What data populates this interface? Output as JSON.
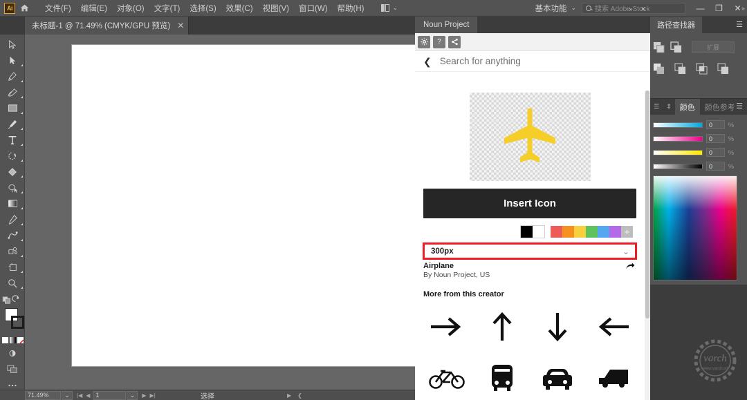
{
  "app": {
    "logo": "Ai",
    "home_icon": "home-icon",
    "workspace": "基本功能",
    "stock_placeholder": "搜索 Adobe Stock",
    "window_buttons": [
      "—",
      "❐",
      "✕"
    ]
  },
  "menu": {
    "items": [
      {
        "label": "文件(F)"
      },
      {
        "label": "编辑(E)"
      },
      {
        "label": "对象(O)"
      },
      {
        "label": "文字(T)"
      },
      {
        "label": "选择(S)"
      },
      {
        "label": "效果(C)"
      },
      {
        "label": "视图(V)"
      },
      {
        "label": "窗口(W)"
      },
      {
        "label": "帮助(H)"
      }
    ]
  },
  "document_tab": {
    "title": "未标题-1 @ 71.49% (CMYK/GPU 预览)",
    "close": "✕"
  },
  "toolbar": {
    "tools": [
      {
        "name": "selection-tool"
      },
      {
        "name": "direct-selection-tool"
      },
      {
        "name": "pen-tool"
      },
      {
        "name": "curvature-tool"
      },
      {
        "name": "rectangle-tool"
      },
      {
        "name": "paintbrush-tool"
      },
      {
        "name": "type-tool"
      },
      {
        "name": "rotate-tool"
      },
      {
        "name": "shape-builder-tool"
      },
      {
        "name": "eyedropper-lasso-tool"
      },
      {
        "name": "gradient-tool"
      },
      {
        "name": "eyedropper-tool"
      },
      {
        "name": "blend-tool"
      },
      {
        "name": "symbol-sprayer-tool"
      },
      {
        "name": "artboard-tool"
      },
      {
        "name": "zoom-tool"
      }
    ],
    "fill_color": "#ffffff",
    "stroke_color": "#1c1c1c"
  },
  "statusbar": {
    "zoom": "71.49%",
    "page": "1",
    "status_text": "选择",
    "nav": [
      "|◀",
      "◀",
      "▶",
      "▶|"
    ]
  },
  "noun_project": {
    "panel_tab": "Noun Project",
    "collapse": "»",
    "close": "✕",
    "toolstrip": [
      {
        "name": "gear-icon",
        "glyph": "✿"
      },
      {
        "name": "help-icon",
        "glyph": "?"
      },
      {
        "name": "share-icon",
        "glyph": "➤"
      }
    ],
    "back_arrow": "❮",
    "search_label": "Search for anything",
    "preview_icon": "airplane-icon",
    "preview_color": "#F5CE2A",
    "insert_button": "Insert Icon",
    "swatches": {
      "mono": [
        "#000000",
        "#ffffff"
      ],
      "colors": [
        "#ec5b57",
        "#f59120",
        "#f7d03c",
        "#5fc25f",
        "#55a7f0",
        "#b469e8"
      ],
      "add": "+"
    },
    "size": {
      "value": "300px",
      "chevron": "⌄",
      "highlight_color": "#ee1c24"
    },
    "icon_name": "Airplane",
    "icon_author": "By Noun Project, US",
    "share_icon": "➤",
    "more_title": "More from this creator",
    "grid_icons": [
      {
        "name": "arrow-right-icon"
      },
      {
        "name": "arrow-up-icon"
      },
      {
        "name": "arrow-down-icon"
      },
      {
        "name": "arrow-left-icon"
      },
      {
        "name": "bicycle-icon"
      },
      {
        "name": "bus-icon"
      },
      {
        "name": "car-icon"
      },
      {
        "name": "truck-icon"
      }
    ]
  },
  "dock": {
    "collapse": "»",
    "pathfinder": {
      "tab": "路径查找器",
      "menu": "☰",
      "expand_button": "扩展"
    },
    "color": {
      "handle": "☰",
      "tabs": [
        {
          "label": "颜色",
          "active": true
        },
        {
          "label": "颜色参考",
          "active": false
        }
      ],
      "menu": "☰",
      "channels": [
        {
          "name": "C",
          "value": "0",
          "unit": "%"
        },
        {
          "name": "M",
          "value": "0",
          "unit": "%"
        },
        {
          "name": "Y",
          "value": "0",
          "unit": "%"
        },
        {
          "name": "K",
          "value": "0",
          "unit": "%"
        }
      ]
    }
  },
  "watermark": {
    "text": "varch",
    "sub": "www.varch.cn"
  }
}
